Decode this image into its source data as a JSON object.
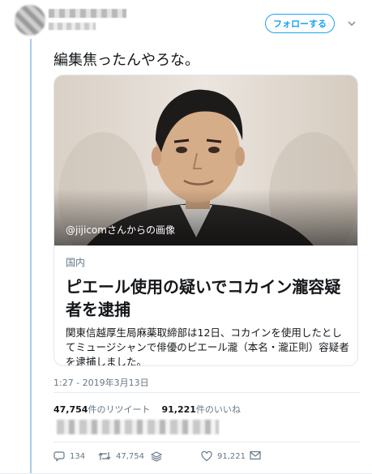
{
  "tweet": {
    "follow_label": "フォローする",
    "text": "編集焦ったんやろな。",
    "timestamp": "1:27 - 2019年3月13日"
  },
  "card": {
    "image_credit": "@jijicomさんからの画像",
    "category": "国内",
    "title": "ピエール使用の疑いでコカイン瀧容疑者を逮捕",
    "description": "関東信越厚生局麻薬取締部は12日、コカインを使用したとしてミュージシャンで俳優のピエール瀧（本名・瀧正則）容疑者を逮捕しました。"
  },
  "stats": {
    "retweets_count": "47,754",
    "retweets_label": "件のリツイート",
    "likes_count": "91,221",
    "likes_label": "件のいいね"
  },
  "actions": {
    "reply_count": "134",
    "retweet_count": "47,754",
    "like_count": "91,221"
  },
  "icons": {
    "chevron": "chevron-down-icon",
    "reply": "reply-icon",
    "retweet": "retweet-icon",
    "stack": "stack-icon",
    "like": "heart-icon",
    "dm": "envelope-icon"
  },
  "colors": {
    "accent": "#1da1f2",
    "thread": "#a9cce8",
    "muted": "#657786",
    "text": "#14171a"
  }
}
